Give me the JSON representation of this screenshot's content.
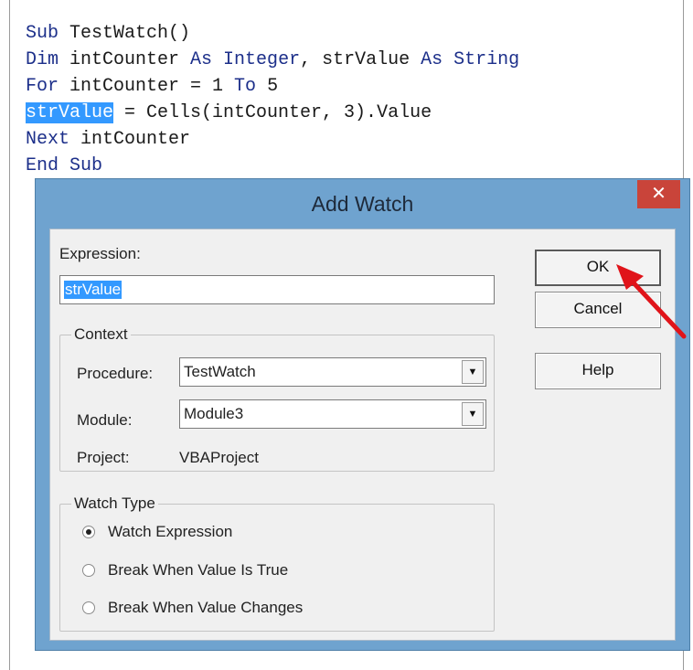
{
  "code": {
    "line1": {
      "kw": "Sub",
      "rest": " TestWatch()"
    },
    "line2": {
      "kw1": "Dim",
      "mid1": " intCounter ",
      "kw2": "As Integer",
      "mid2": ", strValue ",
      "kw3": "As String"
    },
    "line3": {
      "kw1": "For",
      "mid": " intCounter = 1 ",
      "kw2": "To",
      "rest": " 5"
    },
    "line4": {
      "selected": "strValue",
      "rest": " = Cells(intCounter, 3).Value"
    },
    "line5": {
      "kw": "Next",
      "rest": " intCounter"
    },
    "line6": {
      "kw": "End Sub"
    }
  },
  "dialog": {
    "title": "Add Watch",
    "close_glyph": "✕",
    "expression_label": "Expression:",
    "expression_value": "strValue",
    "context": {
      "legend": "Context",
      "procedure_label": "Procedure:",
      "procedure_value": "TestWatch",
      "module_label": "Module:",
      "module_value": "Module3",
      "project_label": "Project:",
      "project_value": "VBAProject"
    },
    "watch_type": {
      "legend": "Watch Type",
      "options": [
        "Watch Expression",
        "Break When Value Is True",
        "Break When Value Changes"
      ],
      "selected": "Watch Expression"
    },
    "buttons": {
      "ok": "OK",
      "cancel": "Cancel",
      "help": "Help"
    },
    "dropdown_glyph": "▼"
  },
  "colors": {
    "selection": "#3399ff",
    "keyword": "#1c2f8a",
    "window_frame": "#6fa3cf",
    "close_button": "#c9443a",
    "arrow": "#e0141a"
  }
}
